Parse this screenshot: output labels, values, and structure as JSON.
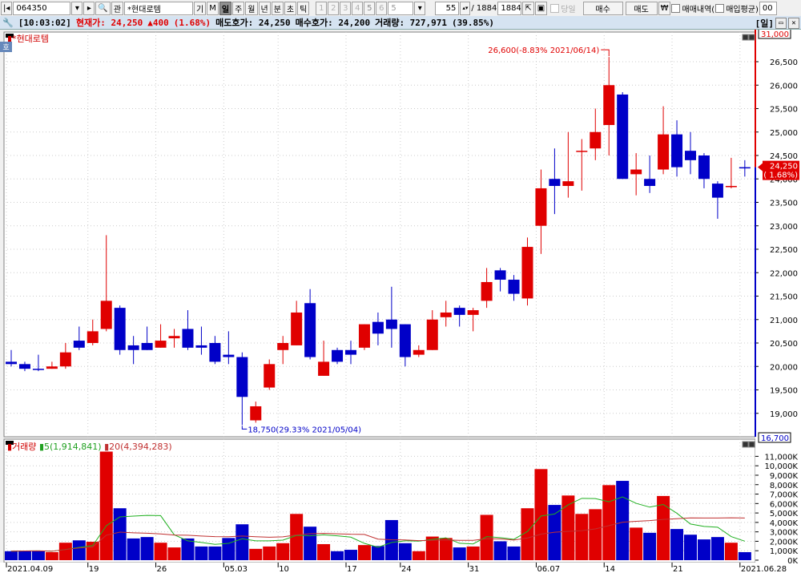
{
  "toolbar": {
    "code": "064350",
    "name": "*현대로템",
    "gi": "기",
    "m": "M",
    "watch": "관",
    "periods": [
      "일",
      "주",
      "월",
      "년",
      "분",
      "초",
      "틱"
    ],
    "selected_period": "일",
    "numbers": [
      "1",
      "2",
      "3",
      "4",
      "5",
      "6",
      "5"
    ],
    "count": "55",
    "total_sep": "/ 1884",
    "total": "1884",
    "today": "당일",
    "buy": "매수",
    "sell": "매도",
    "won": "₩",
    "trade_history": "매매내역(",
    "avg_price": "매입평균)",
    "tail": "00"
  },
  "info": {
    "time": "[10:03:02]",
    "price": "현재가: 24,250",
    "change": "▲400",
    "rate": "(1.68%)",
    "ask": "매도호가: 24,250",
    "bid": "매수호가: 24,200",
    "volume": "거래량: 727,971",
    "vol_rate": "(39.85%)",
    "period": "[일]"
  },
  "pane": {
    "title": "*현대로템",
    "badge": "호"
  },
  "colors": {
    "up": "#e00000",
    "down": "#0000c8",
    "ma5": "#20b020",
    "ma20": "#c03030"
  },
  "chart_data": [
    {
      "type": "candlestick",
      "title": "*현대로템",
      "ylim": [
        18500,
        26900
      ],
      "yticks": [
        19000,
        19500,
        20000,
        20500,
        21000,
        21500,
        22000,
        22500,
        23000,
        23500,
        24000,
        24500,
        25000,
        25500,
        26000,
        26500
      ],
      "ytick_labels": [
        "19,000",
        "19,500",
        "20,000",
        "20,500",
        "21,000",
        "21,500",
        "22,000",
        "22,500",
        "23,000",
        "23,500",
        "24,000",
        "24,500",
        "25,000",
        "25,500",
        "26,000",
        "26,500"
      ],
      "axis_top_label": "31,000",
      "axis_bottom_label": "16,700",
      "current_label": "24,250",
      "current_rate": "( 1.68%)",
      "current": 24250,
      "high_annotation": "26,600(-8.83% 2021/06/14)",
      "high_index": 44,
      "high": 26600,
      "low_annotation": "18,750(29.33% 2021/05/04)",
      "low_index": 17,
      "low": 18750,
      "ohlc": [
        [
          20100,
          20350,
          20000,
          20050
        ],
        [
          20050,
          20100,
          19900,
          19950
        ],
        [
          19950,
          20250,
          19900,
          19950
        ],
        [
          19950,
          20100,
          19950,
          20000
        ],
        [
          20000,
          20500,
          19950,
          20300
        ],
        [
          20550,
          20850,
          20350,
          20400
        ],
        [
          20500,
          21000,
          20450,
          20750
        ],
        [
          20800,
          22800,
          20750,
          21400
        ],
        [
          21250,
          21300,
          20250,
          20350
        ],
        [
          20450,
          20650,
          20050,
          20350
        ],
        [
          20500,
          20850,
          20350,
          20350
        ],
        [
          20400,
          20900,
          20400,
          20550
        ],
        [
          20600,
          20800,
          20400,
          20650
        ],
        [
          20800,
          21200,
          20350,
          20400
        ],
        [
          20450,
          20850,
          20250,
          20400
        ],
        [
          20500,
          20650,
          20050,
          20100
        ],
        [
          20250,
          20750,
          20050,
          20200
        ],
        [
          20200,
          20300,
          18750,
          19350
        ],
        [
          18850,
          19250,
          18800,
          19150
        ],
        [
          19550,
          20150,
          19500,
          20050
        ],
        [
          20350,
          20650,
          20050,
          20500
        ],
        [
          20450,
          21400,
          20450,
          21150
        ],
        [
          21350,
          21650,
          20150,
          20200
        ],
        [
          19800,
          20550,
          19800,
          20100
        ],
        [
          20350,
          20400,
          20050,
          20100
        ],
        [
          20350,
          20550,
          20050,
          20250
        ],
        [
          20400,
          20900,
          20350,
          20900
        ],
        [
          20950,
          21150,
          20450,
          20700
        ],
        [
          21000,
          21700,
          20400,
          20800
        ],
        [
          20900,
          20900,
          20000,
          20200
        ],
        [
          20250,
          20450,
          20200,
          20350
        ],
        [
          20350,
          21200,
          20350,
          21000
        ],
        [
          21050,
          21400,
          20850,
          21150
        ],
        [
          21250,
          21300,
          20850,
          21100
        ],
        [
          21100,
          21250,
          20750,
          21200
        ],
        [
          21400,
          22100,
          21250,
          21800
        ],
        [
          22050,
          22100,
          21600,
          21850
        ],
        [
          21850,
          21950,
          21400,
          21550
        ],
        [
          21450,
          22750,
          21300,
          22550
        ],
        [
          23000,
          24200,
          22400,
          23800
        ],
        [
          24000,
          24650,
          23250,
          23850
        ],
        [
          23850,
          25000,
          23600,
          23950
        ],
        [
          24600,
          24850,
          23750,
          24600
        ],
        [
          24650,
          25500,
          24400,
          25000
        ],
        [
          25150,
          26600,
          24500,
          26000
        ],
        [
          25800,
          25850,
          24000,
          24000
        ],
        [
          24100,
          24550,
          23650,
          24200
        ],
        [
          24000,
          24500,
          23700,
          23850
        ],
        [
          24200,
          25550,
          24100,
          24950
        ],
        [
          24950,
          25250,
          24050,
          24250
        ],
        [
          24600,
          25000,
          24100,
          24400
        ],
        [
          24500,
          24550,
          23800,
          24000
        ],
        [
          23900,
          23950,
          23150,
          23600
        ],
        [
          23850,
          24450,
          23800,
          23850
        ],
        [
          24250,
          24400,
          24050,
          24250
        ]
      ],
      "directions": [
        "d",
        "d",
        "d",
        "u",
        "u",
        "d",
        "u",
        "u",
        "d",
        "d",
        "d",
        "u",
        "u",
        "d",
        "d",
        "d",
        "d",
        "d",
        "u",
        "u",
        "u",
        "u",
        "d",
        "u",
        "d",
        "d",
        "u",
        "d",
        "d",
        "d",
        "u",
        "u",
        "u",
        "d",
        "u",
        "u",
        "d",
        "d",
        "u",
        "u",
        "d",
        "u",
        "u",
        "u",
        "u",
        "d",
        "u",
        "d",
        "u",
        "d",
        "d",
        "d",
        "d",
        "u",
        "d"
      ]
    },
    {
      "type": "bar",
      "title": "거래량",
      "legend": [
        "거래량",
        "5(1,914,841)",
        "20(4,394,283)"
      ],
      "ylim": [
        0,
        11800
      ],
      "unit": "K",
      "yticks": [
        0,
        1000,
        2000,
        3000,
        4000,
        5000,
        6000,
        7000,
        8000,
        9000,
        10000,
        11000
      ],
      "ytick_labels": [
        "0K",
        "1,000K",
        "2,000K",
        "3,000K",
        "4,000K",
        "5,000K",
        "6,000K",
        "7,000K",
        "8,000K",
        "9,000K",
        "10,000K",
        "11,000K"
      ],
      "values": [
        950,
        1000,
        1000,
        850,
        1850,
        2100,
        1950,
        11500,
        5500,
        2300,
        2450,
        1850,
        1350,
        2300,
        1450,
        1450,
        2350,
        3800,
        1200,
        1450,
        1800,
        4900,
        3550,
        1700,
        950,
        1100,
        1600,
        1500,
        4250,
        1800,
        950,
        2500,
        2350,
        1350,
        1450,
        4800,
        2000,
        1450,
        5500,
        9650,
        5850,
        6850,
        4900,
        5400,
        7950,
        8400,
        3450,
        2900,
        6800,
        3300,
        2700,
        2200,
        2450,
        1850,
        850
      ],
      "x_labels": [
        {
          "i": 0,
          "label": "2021.04.09"
        },
        {
          "i": 6,
          "label": "19"
        },
        {
          "i": 11,
          "label": "26"
        },
        {
          "i": 16,
          "label": "05.03"
        },
        {
          "i": 20,
          "label": "10"
        },
        {
          "i": 25,
          "label": "17"
        },
        {
          "i": 29,
          "label": "24"
        },
        {
          "i": 34,
          "label": "31"
        },
        {
          "i": 39,
          "label": "06.07"
        },
        {
          "i": 44,
          "label": "14"
        },
        {
          "i": 49,
          "label": "21"
        },
        {
          "i": 54,
          "label": "2021.06.28"
        }
      ]
    }
  ]
}
